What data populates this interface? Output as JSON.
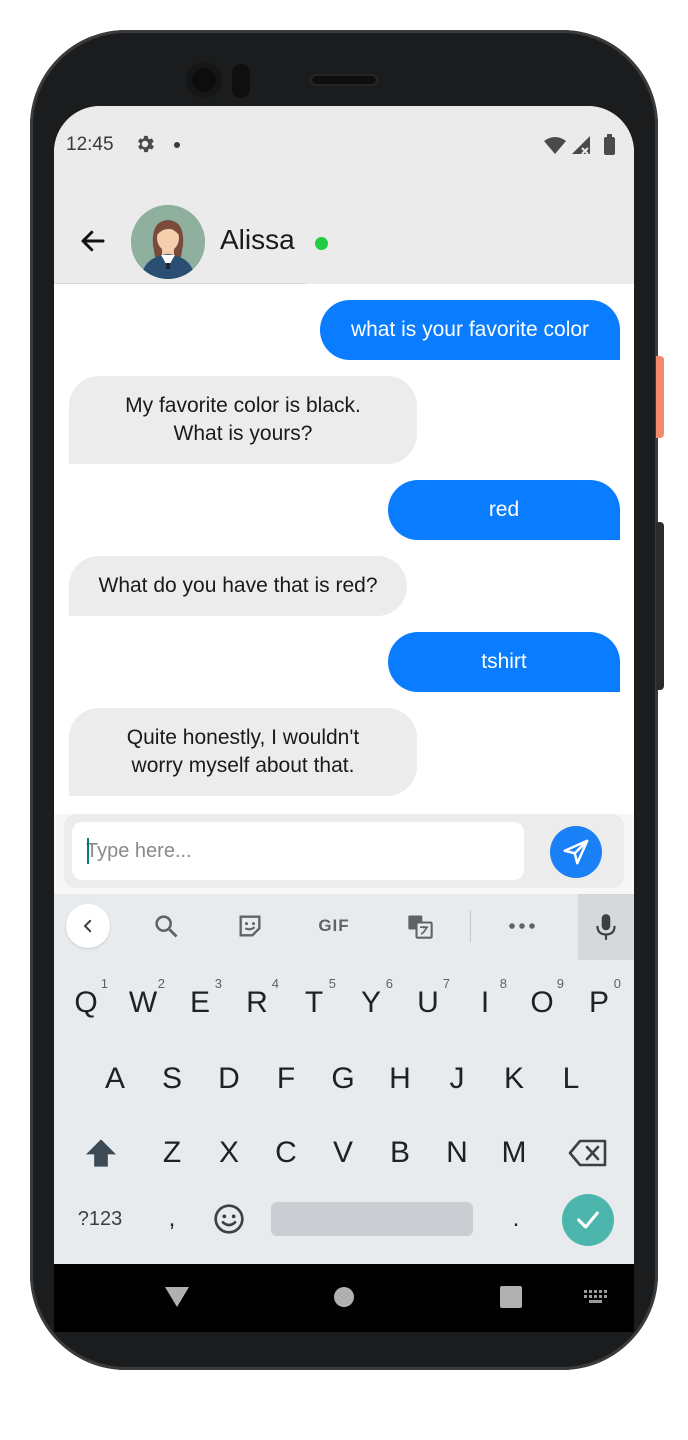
{
  "status_bar": {
    "time": "12:45"
  },
  "header": {
    "contact_name": "Alissa",
    "online": true
  },
  "messages": [
    {
      "from": "me",
      "text": "what is your favorite color"
    },
    {
      "from": "bot",
      "text": "My favorite color is black.\nWhat is yours?"
    },
    {
      "from": "me",
      "text": "red"
    },
    {
      "from": "bot",
      "text": "What do you have that is red?"
    },
    {
      "from": "me",
      "text": "tshirt"
    },
    {
      "from": "bot",
      "text": "Quite honestly, I wouldn't\nworry myself about that."
    }
  ],
  "composer": {
    "placeholder": "Type here...",
    "value": ""
  },
  "keyboard": {
    "toolbar": {
      "gif_label": "GIF"
    },
    "row1": [
      "Q",
      "W",
      "E",
      "R",
      "T",
      "Y",
      "U",
      "I",
      "O",
      "P"
    ],
    "row1_hints": [
      "1",
      "2",
      "3",
      "4",
      "5",
      "6",
      "7",
      "8",
      "9",
      "0"
    ],
    "row2": [
      "A",
      "S",
      "D",
      "F",
      "G",
      "H",
      "J",
      "K",
      "L"
    ],
    "row3": [
      "Z",
      "X",
      "C",
      "V",
      "B",
      "N",
      "M"
    ],
    "symbols_label": "?123",
    "comma": ",",
    "period": "."
  },
  "colors": {
    "accent": "#0a7cff",
    "online": "#22cc44",
    "enter": "#4db6ac"
  }
}
